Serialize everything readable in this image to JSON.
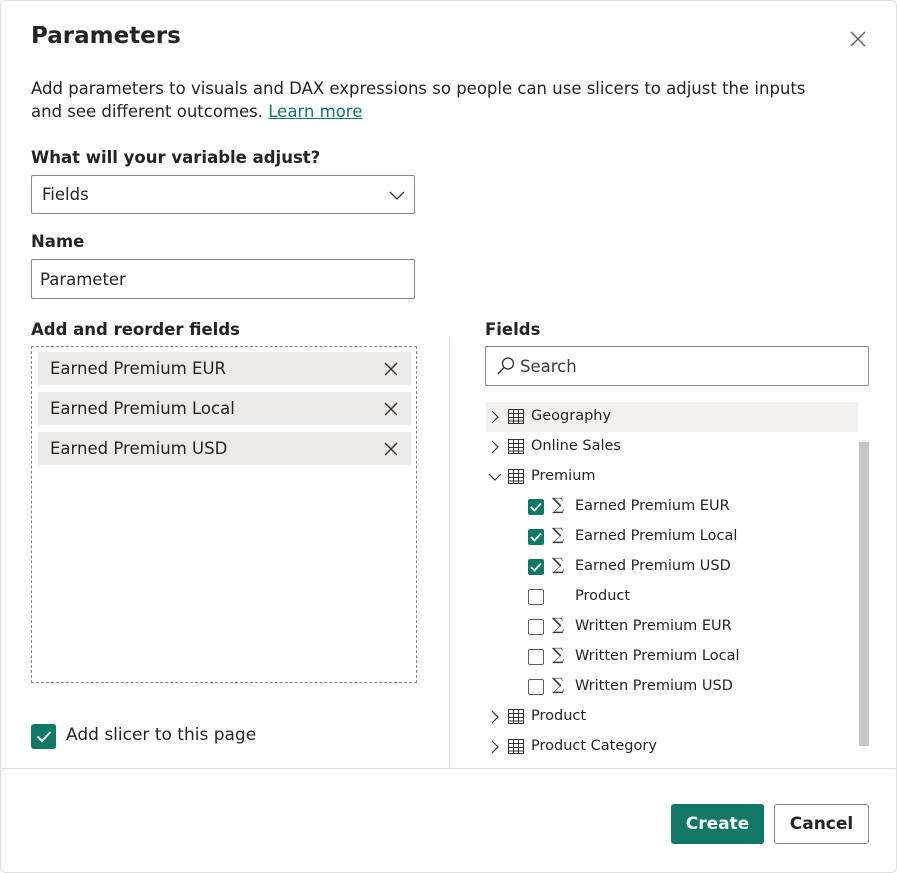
{
  "dialog": {
    "title": "Parameters",
    "description": "Add parameters to visuals and DAX expressions so people can use slicers to adjust the inputs and see different outcomes.",
    "learn_more": "Learn more"
  },
  "variable": {
    "label": "What will your variable adjust?",
    "selected": "Fields"
  },
  "name": {
    "label": "Name",
    "value": "Parameter"
  },
  "reorder": {
    "label": "Add and reorder fields",
    "items": [
      "Earned Premium EUR",
      "Earned Premium Local",
      "Earned Premium USD"
    ]
  },
  "fields": {
    "label": "Fields",
    "search_placeholder": "Search",
    "tree": [
      {
        "label": "Geography",
        "type": "table",
        "expanded": false
      },
      {
        "label": "Online Sales",
        "type": "table",
        "expanded": false
      },
      {
        "label": "Premium",
        "type": "table",
        "expanded": true
      },
      {
        "label": "Earned Premium EUR",
        "type": "measure",
        "checked": true
      },
      {
        "label": "Earned Premium Local",
        "type": "measure",
        "checked": true
      },
      {
        "label": "Earned Premium USD",
        "type": "measure",
        "checked": true
      },
      {
        "label": "Product",
        "type": "column",
        "checked": false
      },
      {
        "label": "Written Premium EUR",
        "type": "measure",
        "checked": false
      },
      {
        "label": "Written Premium Local",
        "type": "measure",
        "checked": false
      },
      {
        "label": "Written Premium USD",
        "type": "measure",
        "checked": false
      },
      {
        "label": "Product",
        "type": "table",
        "expanded": false
      },
      {
        "label": "Product Category",
        "type": "table",
        "expanded": false
      }
    ]
  },
  "slicer": {
    "label": "Add slicer to this page",
    "checked": true
  },
  "buttons": {
    "create": "Create",
    "cancel": "Cancel"
  },
  "colors": {
    "accent": "#117865"
  }
}
